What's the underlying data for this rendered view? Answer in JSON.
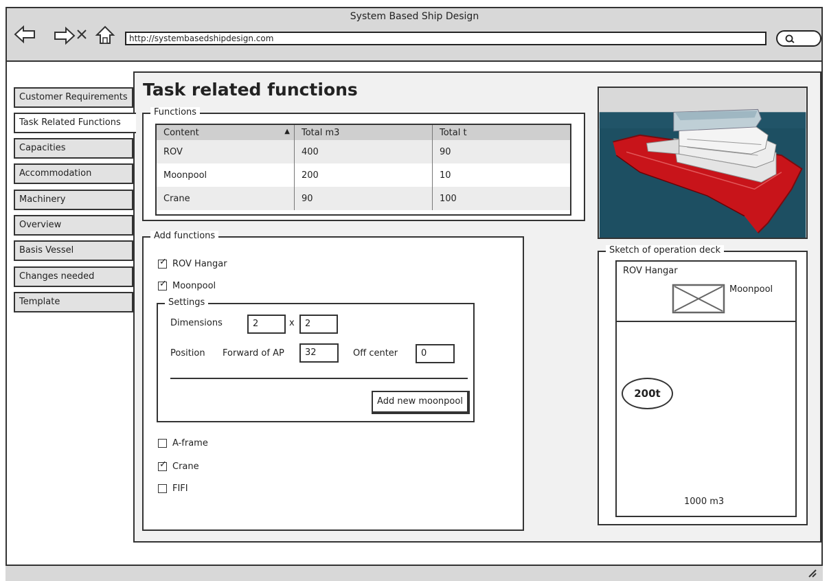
{
  "window": {
    "title": "System Based Ship Design"
  },
  "address_bar": {
    "url": "http://systembasedshipdesign.com"
  },
  "sidebar": {
    "items": [
      {
        "label": "Customer Requirements"
      },
      {
        "label": "Task Related Functions"
      },
      {
        "label": "Capacities"
      },
      {
        "label": "Accommodation"
      },
      {
        "label": "Machinery"
      },
      {
        "label": "Overview"
      },
      {
        "label": "Basis Vessel"
      },
      {
        "label": "Changes needed"
      },
      {
        "label": "Template"
      }
    ],
    "active_index": 1
  },
  "main": {
    "title": "Task related functions",
    "functions": {
      "legend": "Functions",
      "columns": [
        "Content",
        "Total m3",
        "Total t"
      ],
      "rows": [
        [
          "ROV",
          "400",
          "90"
        ],
        [
          "Moonpool",
          "200",
          "10"
        ],
        [
          "Crane",
          "90",
          "100"
        ]
      ]
    },
    "add_functions": {
      "legend": "Add functions",
      "rov_hangar": {
        "label": "ROV Hangar",
        "checked": true
      },
      "moonpool": {
        "label": "Moonpool",
        "checked": true
      },
      "settings": {
        "legend": "Settings",
        "dimensions_label": "Dimensions",
        "dim_a": "2",
        "times": "x",
        "dim_b": "2",
        "position_label": "Position",
        "forward_label": "Forward of AP",
        "forward_value": "32",
        "offcenter_label": "Off center",
        "offcenter_value": "0",
        "add_button": "Add new moonpool"
      },
      "aframe": {
        "label": "A-frame",
        "checked": false
      },
      "crane": {
        "label": "Crane",
        "checked": true
      },
      "fifi": {
        "label": "FIFI",
        "checked": false
      }
    },
    "sketch": {
      "legend": "Sketch of operation deck",
      "rov_hangar": "ROV Hangar",
      "moonpool": "Moonpool",
      "crane_load": "200t",
      "deck_area": "1000 m3"
    }
  },
  "colors": {
    "chrome": "#d8d8d8",
    "panel": "#f1f1f1",
    "hull_red": "#c8141a",
    "sea": "#1d4f62"
  }
}
